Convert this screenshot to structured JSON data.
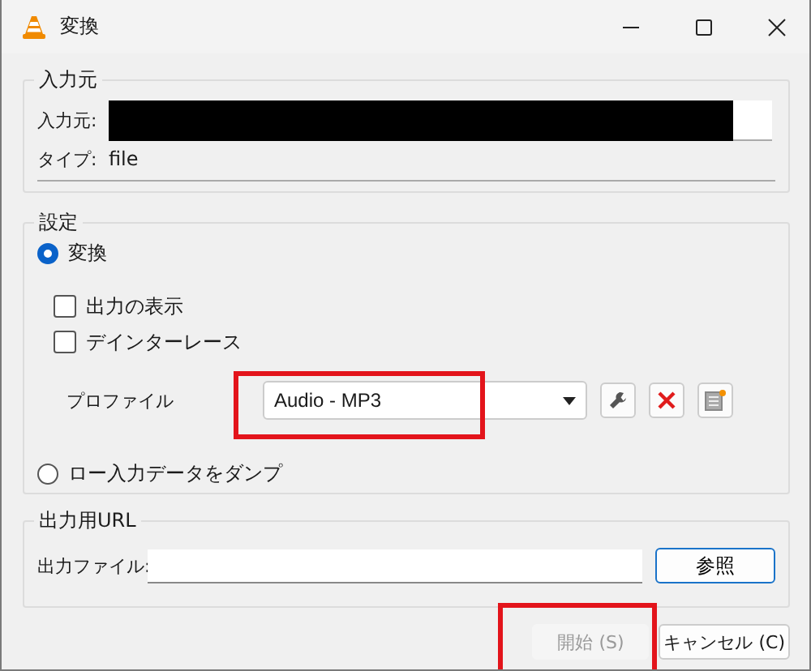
{
  "window": {
    "title": "変換"
  },
  "source": {
    "legend": "入力元",
    "label": "入力元:",
    "type_label": "タイプ:",
    "type_value": "file"
  },
  "settings": {
    "legend": "設定",
    "modes": [
      {
        "label": "変換",
        "selected": true
      },
      {
        "label": "ロー入力データをダンプ",
        "selected": false
      }
    ],
    "checkboxes": [
      {
        "label": "出力の表示",
        "checked": false
      },
      {
        "label": "デインターレース",
        "checked": false
      }
    ],
    "profile": {
      "label": "プロファイル",
      "value": "Audio - MP3"
    }
  },
  "output": {
    "legend": "出力用URL",
    "label": "出力ファイル:",
    "browse": "参照"
  },
  "buttons": [
    {
      "label": "開始 (S)",
      "disabled": true
    },
    {
      "label": "キャンセル (C)",
      "disabled": false
    }
  ]
}
